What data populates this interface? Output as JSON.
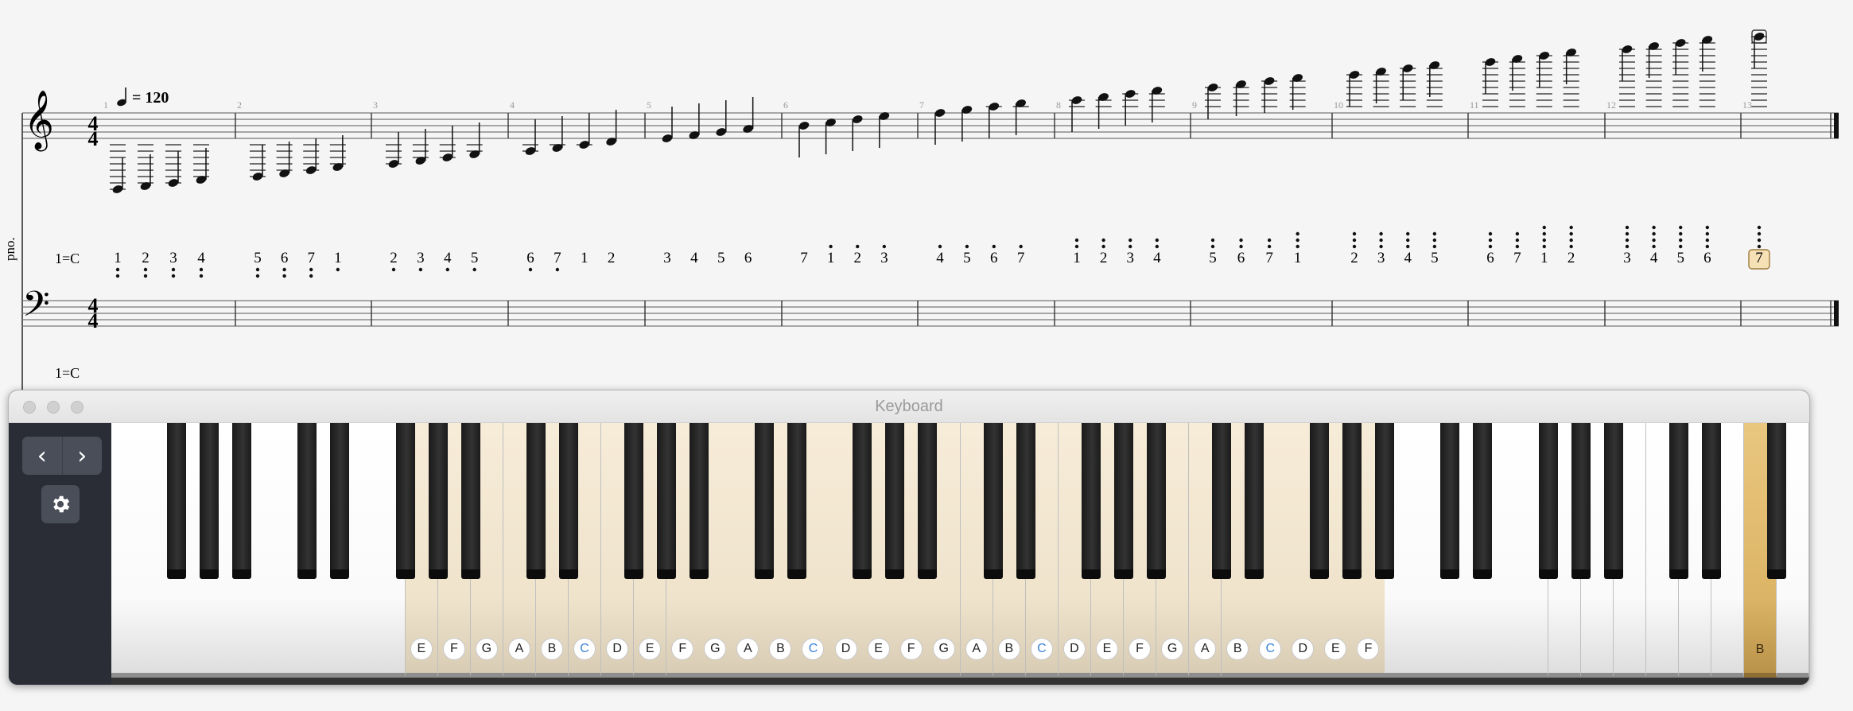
{
  "score": {
    "tempo": "= 120",
    "time_signature": [
      "4",
      "4"
    ],
    "staff_label": "pno.",
    "key_label": "1=C",
    "key_label_bass": "1=C",
    "measure_numbers": [
      "1",
      "2",
      "3",
      "4",
      "5",
      "6",
      "7",
      "8",
      "9",
      "10",
      "11",
      "12",
      "13"
    ],
    "numbered_notation": [
      [
        "1",
        "2",
        "3",
        "4"
      ],
      [
        "5",
        "6",
        "7",
        "1"
      ],
      [
        "2",
        "3",
        "4",
        "5"
      ],
      [
        "6",
        "7",
        "1",
        "2"
      ],
      [
        "3",
        "4",
        "5",
        "6"
      ],
      [
        "7",
        "1",
        "2",
        "3"
      ],
      [
        "4",
        "5",
        "6",
        "7"
      ],
      [
        "1",
        "2",
        "3",
        "4"
      ],
      [
        "5",
        "6",
        "7",
        "1"
      ],
      [
        "2",
        "3",
        "4",
        "5"
      ],
      [
        "6",
        "7",
        "1",
        "2"
      ],
      [
        "3",
        "4",
        "5",
        "6"
      ],
      [
        "7"
      ]
    ],
    "selected_note": "7"
  },
  "keyboard": {
    "title": "Keyboard",
    "prev_icon": "chevron-left-icon",
    "next_icon": "chevron-right-icon",
    "settings_icon": "gear-icon",
    "highlight_color": "#f2e6cf",
    "active_color": "#e2bd6f",
    "key_labels": [
      "E",
      "F",
      "G",
      "A",
      "B",
      "C",
      "D",
      "E",
      "F",
      "G",
      "A",
      "B",
      "C",
      "D",
      "E",
      "F",
      "G",
      "A",
      "B",
      "C",
      "D",
      "E",
      "F",
      "G",
      "A",
      "B",
      "C",
      "D",
      "E",
      "F"
    ],
    "active_key_label": "B"
  }
}
